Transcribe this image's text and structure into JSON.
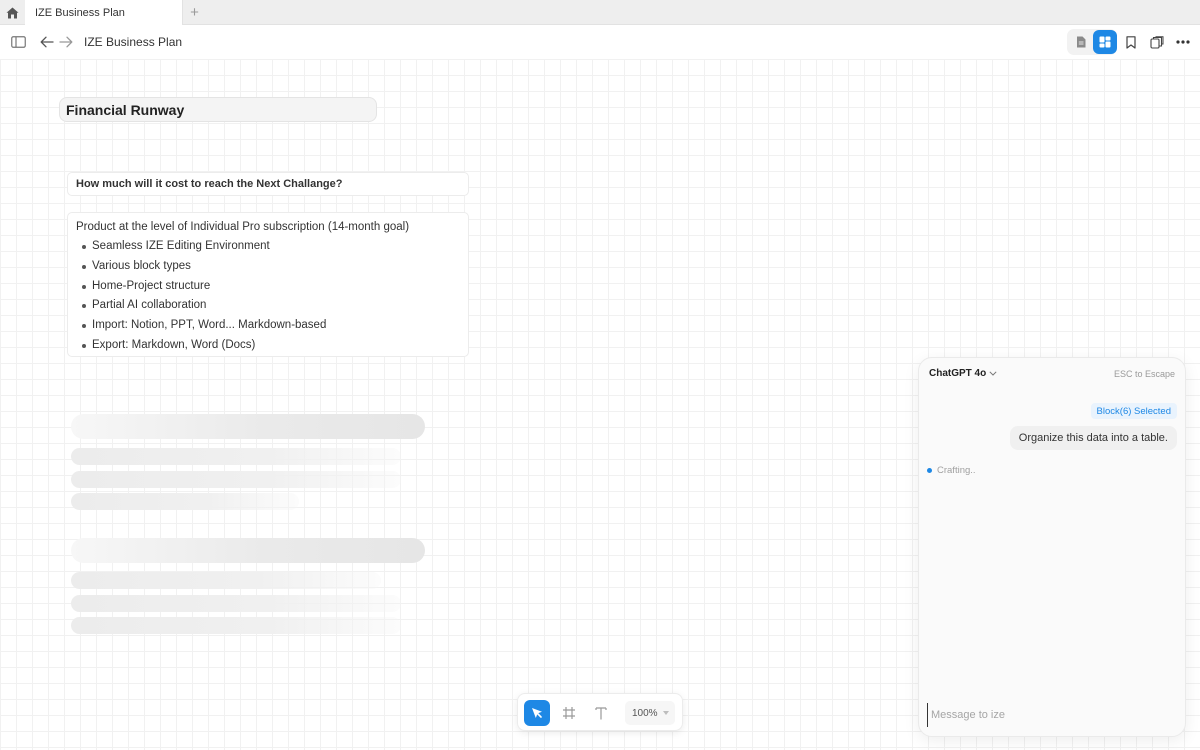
{
  "tabs": [
    {
      "label": "IZE Business Plan",
      "active": true
    }
  ],
  "header": {
    "title": "IZE Business Plan"
  },
  "canvas": {
    "title_block": "Financial Runway",
    "question_block": "How much will it cost to reach the Next Challange?",
    "list_block": {
      "intro": "Product at the level of Individual Pro subscription (14-month goal)",
      "items": [
        "Seamless IZE Editing Environment",
        "Various block types",
        "Home-Project structure",
        "Partial AI collaboration",
        "Import: Notion, PPT, Word... Markdown-based",
        "Export: Markdown, Word (Docs)"
      ]
    }
  },
  "palette": {
    "zoom": "100%"
  },
  "chat": {
    "model": "ChatGPT 4o",
    "esc_hint": "ESC to Escape",
    "selection_badge": "Block(6) Selected",
    "user_message": "Organize this data into a table.",
    "status": "Crafting..",
    "input_placeholder": "Message to ize"
  },
  "colors": {
    "accent": "#1e88e5",
    "tabstrip": "#eeeeee",
    "grid": "#f1f1f1"
  },
  "icons": [
    "home-icon",
    "plus-icon",
    "sidebar-toggle-icon",
    "arrow-left-icon",
    "arrow-right-icon",
    "document-icon",
    "board-icon",
    "bookmark-icon",
    "layers-icon",
    "more-icon",
    "cursor-icon",
    "frame-icon",
    "text-icon",
    "chevron-down-icon"
  ]
}
